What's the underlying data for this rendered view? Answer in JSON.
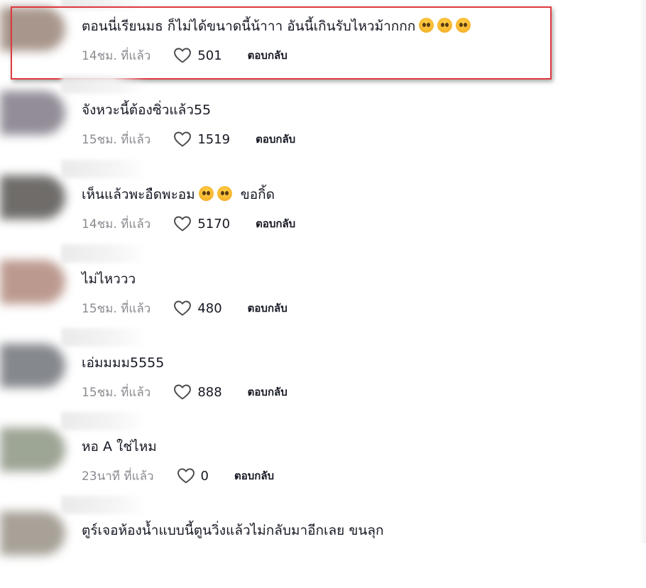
{
  "comments": [
    {
      "text": "ตอนนี่เรียนมธ ก็ไม่ได้ขนาดนี้น้าาา อันนี้เกินรับไหวม้ากกก",
      "emoji_count": 3,
      "time": "14ชม. ที่แล้ว",
      "likes": "501",
      "reply": "ตอบกลับ",
      "avatar_color": "#8b7466",
      "highlighted": true
    },
    {
      "text": "จังหวะนี้ต้องซิ่วแล้ว55",
      "emoji_count": 0,
      "time": "15ชม. ที่แล้ว",
      "likes": "1519",
      "reply": "ตอบกลับ",
      "avatar_color": "#6f6876"
    },
    {
      "text": "เห็นแล้วพะอืดพะอม",
      "emoji_count": 2,
      "text_after": "ขอกิ้ด",
      "time": "14ชม. ที่แล้ว",
      "likes": "5170",
      "reply": "ตอบกลับ",
      "avatar_color": "#3f3c39"
    },
    {
      "text": "ไม่ไหววว",
      "emoji_count": 0,
      "time": "15ชม. ที่แล้ว",
      "likes": "480",
      "reply": "ตอบกลับ",
      "avatar_color": "#a6786a"
    },
    {
      "text": "เอ่มมมม5555",
      "emoji_count": 0,
      "time": "15ชม. ที่แล้ว",
      "likes": "888",
      "reply": "ตอบกลับ",
      "avatar_color": "#5d6168"
    },
    {
      "text": "หอ A ใช่ไหม",
      "emoji_count": 0,
      "time": "23นาที ที่แล้ว",
      "likes": "0",
      "reply": "ตอบกลับ",
      "avatar_color": "#7d8772"
    },
    {
      "text": "ตูร์เจอห้องน้ำแบบนี้ตูนวิ่งแล้วไม่กลับมาอีกเลย ขนลุก",
      "emoji_count": 0,
      "time": "",
      "likes": "",
      "reply": "",
      "avatar_color": "#8a8275"
    }
  ],
  "colors": {
    "highlight_border": "#e0393e",
    "muted_text": "#8a8b91",
    "primary_text": "#161823"
  },
  "icons": {
    "like": "heart-outline-icon",
    "emoji": "pleading-face-emoji"
  }
}
